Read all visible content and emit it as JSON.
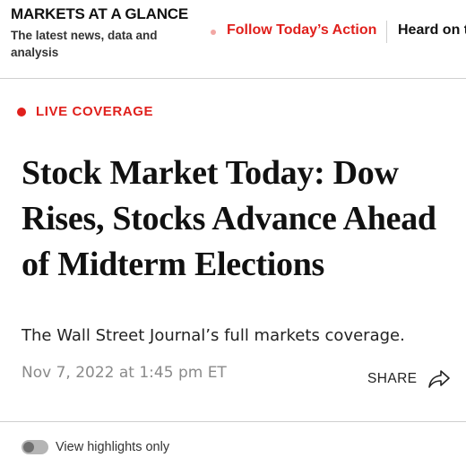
{
  "header": {
    "section_title": "MARKETS AT A GLANCE",
    "section_subtitle": "The latest news, data and analysis",
    "nav": [
      {
        "label": "Follow Today’s Action"
      },
      {
        "label": "Heard on t"
      }
    ]
  },
  "article": {
    "badge": "LIVE COVERAGE",
    "headline": "Stock Market Today: Dow Rises, Stocks Advance Ahead of Midterm Elections",
    "dek": "The Wall Street Journal’s full markets coverage.",
    "timestamp": "Nov 7, 2022 at 1:45 pm ET",
    "share_label": "SHARE"
  },
  "highlights_toggle": {
    "label": "View highlights only",
    "enabled": false
  },
  "colors": {
    "accent_red": "#e0201c",
    "muted_text": "#8a8a8a",
    "divider": "#cfcfcf"
  },
  "icons": {
    "live": "live-dot-icon",
    "share": "share-arrow-icon",
    "toggle": "toggle-switch-icon"
  }
}
